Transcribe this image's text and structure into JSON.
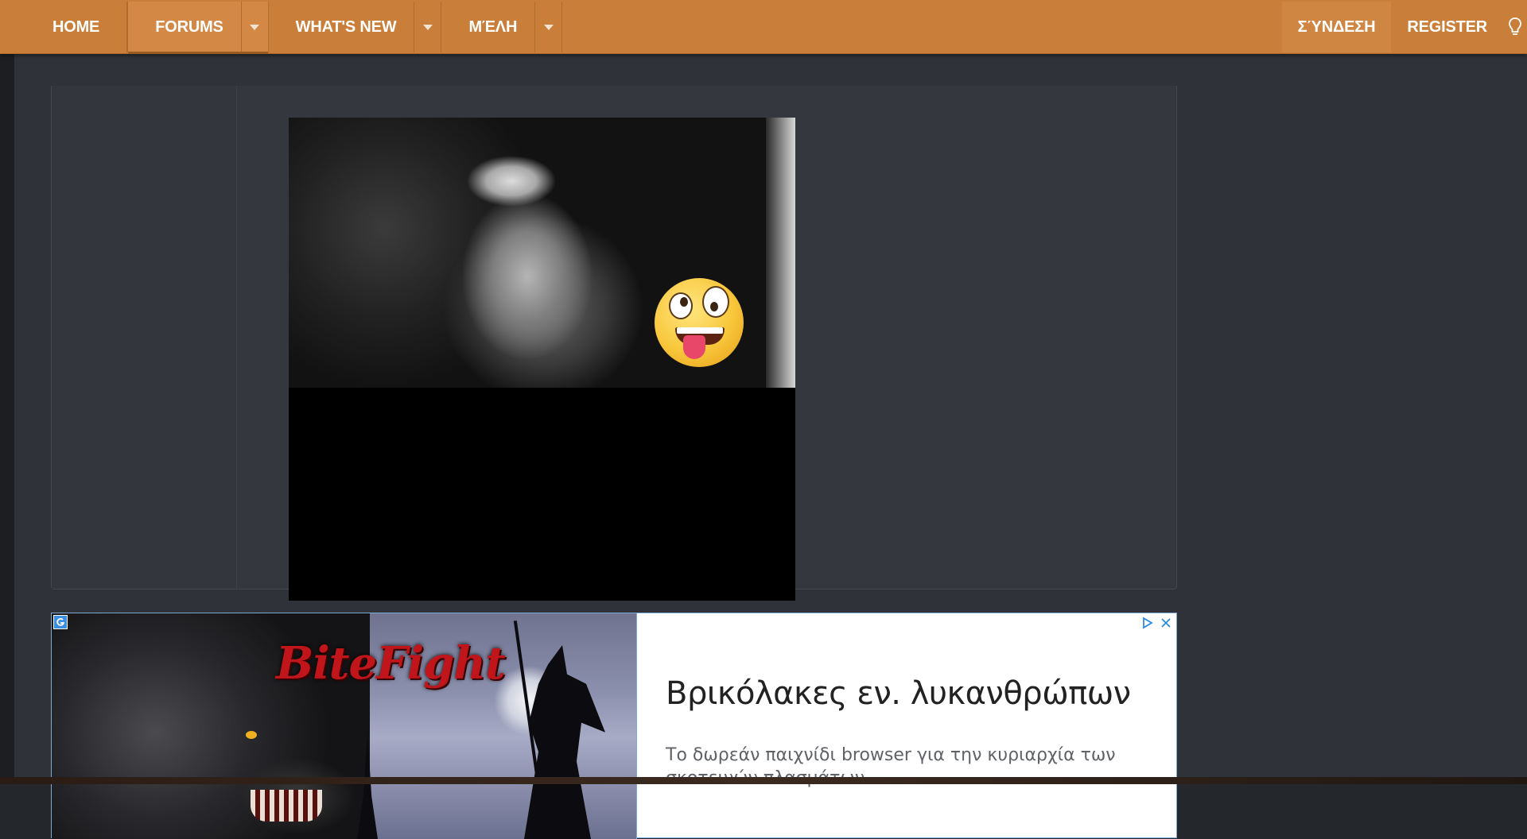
{
  "nav": {
    "home_label": "HOME",
    "forums_label": "FORUMS",
    "whats_new_label": "WHAT'S NEW",
    "members_label": "ΜΈΛΗ",
    "login_label": "ΣΎΝΔΕΣΗ",
    "register_label": "REGISTER",
    "accent_color": "#c97f39"
  },
  "ad": {
    "brand_logo": "BiteFight",
    "title": "Βρικόλακες εν. λυκανθρώπων",
    "description": "Το δωρεάν παιχνίδι browser για την κυριαρχία των σκοτεινών πλασμάτων."
  }
}
